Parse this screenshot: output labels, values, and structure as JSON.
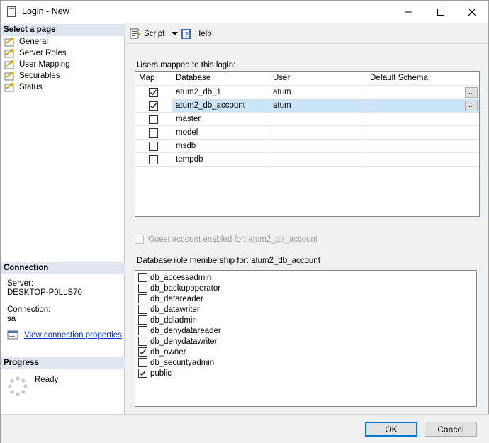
{
  "window": {
    "title": "Login - New"
  },
  "left": {
    "select_page_header": "Select a page",
    "pages": [
      {
        "label": "General"
      },
      {
        "label": "Server Roles"
      },
      {
        "label": "User Mapping"
      },
      {
        "label": "Securables"
      },
      {
        "label": "Status"
      }
    ],
    "connection_header": "Connection",
    "server_label": "Server:",
    "server_value": "DESKTOP-P0LLS70",
    "connection_label": "Connection:",
    "connection_value": "sa",
    "view_connection_link": "View connection properties",
    "progress_header": "Progress",
    "progress_status": "Ready"
  },
  "toolbar": {
    "script_label": "Script",
    "help_label": "Help"
  },
  "mapping": {
    "group_label": "Users mapped to this login:",
    "columns": [
      "Map",
      "Database",
      "User",
      "Default Schema"
    ],
    "rows": [
      {
        "map": true,
        "database": "atum2_db_1",
        "user": "atum",
        "schema": "",
        "has_button": true,
        "selected": false
      },
      {
        "map": true,
        "database": "atum2_db_account",
        "user": "atum",
        "schema": "",
        "has_button": true,
        "selected": true
      },
      {
        "map": false,
        "database": "master",
        "user": "",
        "schema": "",
        "has_button": false,
        "selected": false
      },
      {
        "map": false,
        "database": "model",
        "user": "",
        "schema": "",
        "has_button": false,
        "selected": false
      },
      {
        "map": false,
        "database": "msdb",
        "user": "",
        "schema": "",
        "has_button": false,
        "selected": false
      },
      {
        "map": false,
        "database": "tempdb",
        "user": "",
        "schema": "",
        "has_button": false,
        "selected": false
      }
    ],
    "ellipsis_label": "..."
  },
  "guest": {
    "label": "Guest account enabled for: atum2_db_account",
    "checked": false,
    "enabled": false
  },
  "roles": {
    "group_label": "Database role membership for: atum2_db_account",
    "items": [
      {
        "name": "db_accessadmin",
        "checked": false
      },
      {
        "name": "db_backupoperator",
        "checked": false
      },
      {
        "name": "db_datareader",
        "checked": false
      },
      {
        "name": "db_datawriter",
        "checked": false
      },
      {
        "name": "db_ddladmin",
        "checked": false
      },
      {
        "name": "db_denydatareader",
        "checked": false
      },
      {
        "name": "db_denydatawriter",
        "checked": false
      },
      {
        "name": "db_owner",
        "checked": true
      },
      {
        "name": "db_securityadmin",
        "checked": false
      },
      {
        "name": "public",
        "checked": true
      }
    ]
  },
  "buttons": {
    "ok_label": "OK",
    "cancel_label": "Cancel"
  },
  "colors": {
    "selection": "#cce4f7",
    "section_header": "#dfe6f0",
    "link": "#0033cc",
    "default_button_border": "#0078d7"
  }
}
